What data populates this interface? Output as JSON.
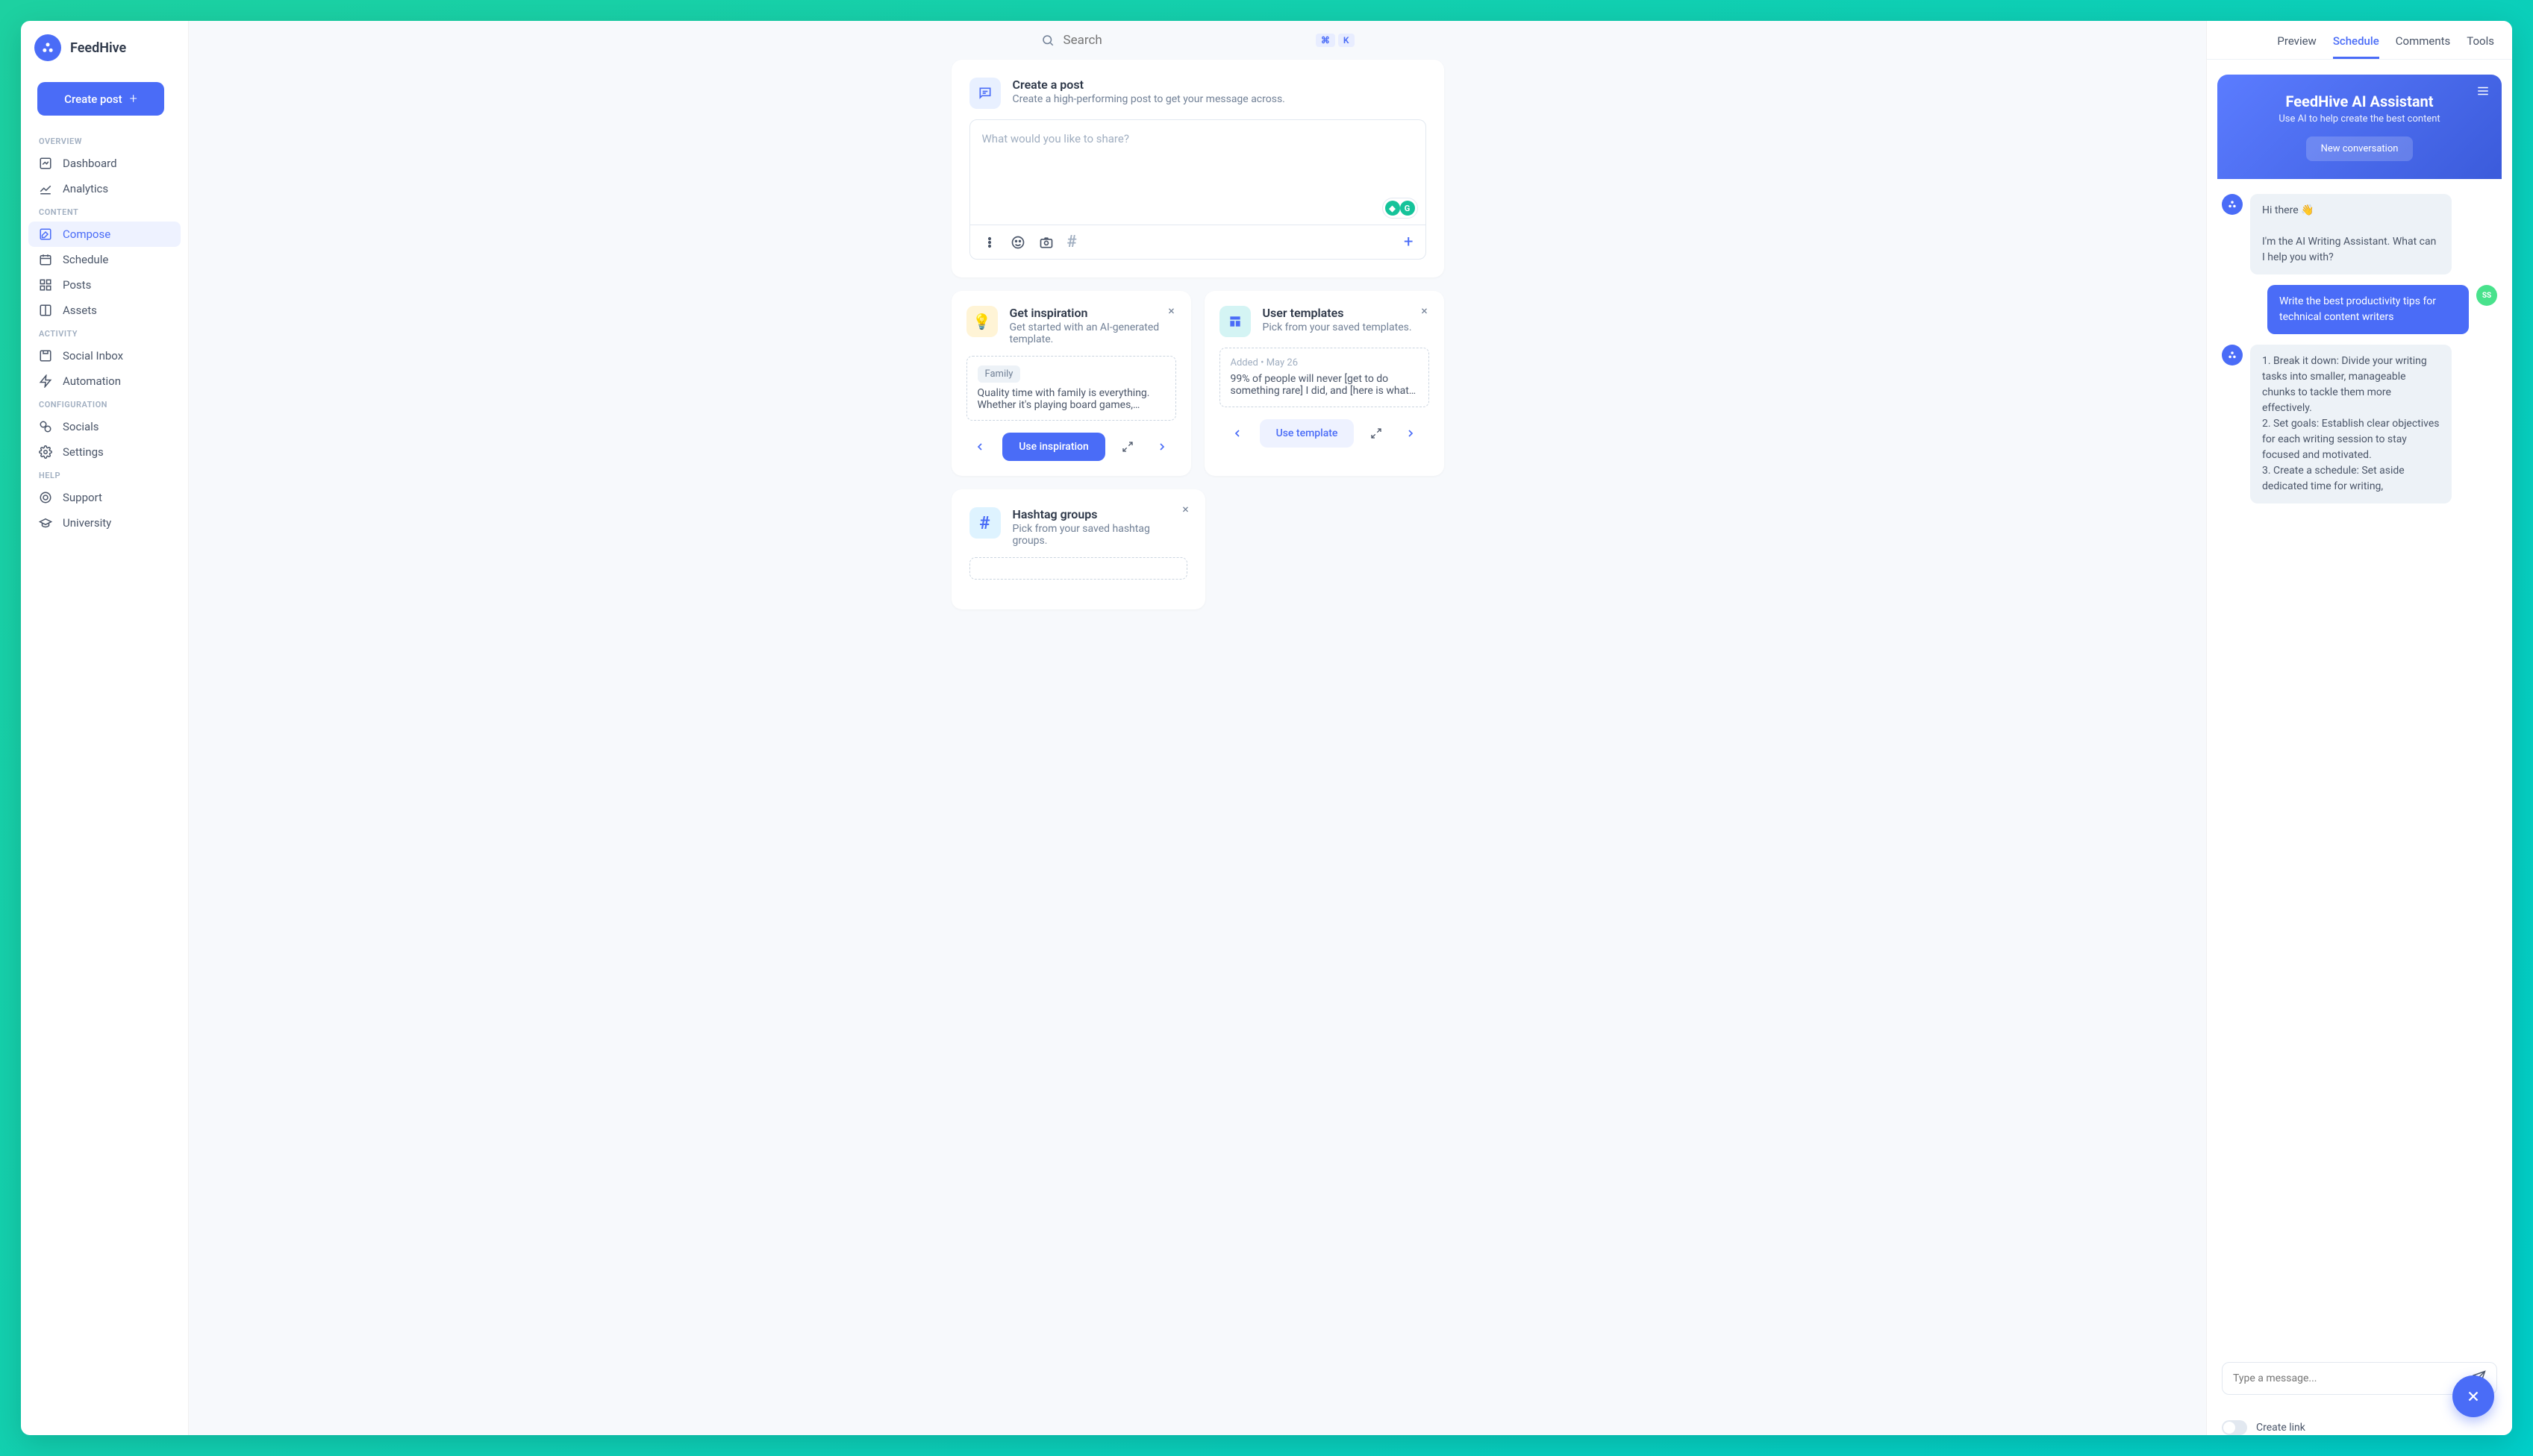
{
  "brand": "FeedHive",
  "create_post_btn": "Create post",
  "search": {
    "placeholder": "Search",
    "kbd1": "⌘",
    "kbd2": "K"
  },
  "sidebar": {
    "sections": {
      "overview": {
        "label": "OVERVIEW",
        "items": [
          "Dashboard",
          "Analytics"
        ]
      },
      "content": {
        "label": "CONTENT",
        "items": [
          "Compose",
          "Schedule",
          "Posts",
          "Assets"
        ]
      },
      "activity": {
        "label": "ACTIVITY",
        "items": [
          "Social Inbox",
          "Automation"
        ]
      },
      "configuration": {
        "label": "CONFIGURATION",
        "items": [
          "Socials",
          "Settings"
        ]
      },
      "help": {
        "label": "HELP",
        "items": [
          "Support",
          "University"
        ]
      }
    }
  },
  "compose": {
    "title": "Create a post",
    "subtitle": "Create a high-performing post to get your message across.",
    "placeholder": "What would you like to share?"
  },
  "inspiration": {
    "title": "Get inspiration",
    "subtitle": "Get started with an AI-generated template.",
    "tag": "Family",
    "text": "Quality time with family is everything. Whether it's playing board games,…",
    "cta": "Use inspiration"
  },
  "templates": {
    "title": "User templates",
    "subtitle": "Pick from your saved templates.",
    "added": "Added • May 26",
    "text": "99% of people will never [get to do something rare] I did, and [here is what…",
    "cta": "Use template"
  },
  "hashtags": {
    "title": "Hashtag groups",
    "subtitle": "Pick from your saved hashtag groups."
  },
  "tabs": [
    "Preview",
    "Schedule",
    "Comments",
    "Tools"
  ],
  "active_tab": "Schedule",
  "ai": {
    "title": "FeedHive AI Assistant",
    "subtitle": "Use AI to help create the best content",
    "new_conversation": "New conversation",
    "messages": [
      {
        "role": "bot",
        "text": "Hi there 👋\n\nI'm the AI Writing Assistant. What can I help you with?"
      },
      {
        "role": "user",
        "text": "Write the best productivity tips for technical content writers"
      },
      {
        "role": "bot",
        "text": "1. Break it down: Divide your writing tasks into smaller, manageable chunks to tackle them more effectively.\n2. Set goals: Establish clear objectives for each writing session to stay focused and motivated.\n3. Create a schedule: Set aside dedicated time for writing,"
      }
    ],
    "input_placeholder": "Type a message...",
    "user_initials": "SS"
  },
  "create_link": "Create link"
}
